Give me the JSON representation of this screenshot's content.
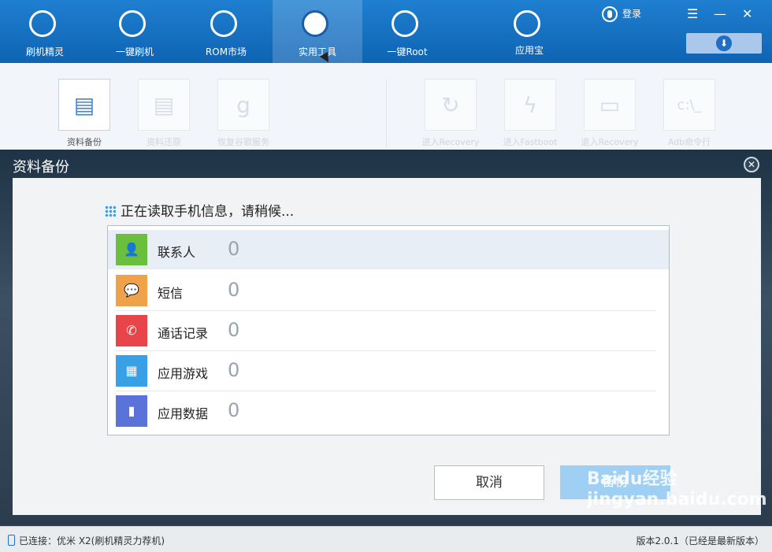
{
  "nav": {
    "items": [
      {
        "label": "刷机精灵",
        "icon": "shield-icon"
      },
      {
        "label": "一键刷机",
        "icon": "cursor-icon"
      },
      {
        "label": "ROM市场",
        "icon": "r-icon"
      },
      {
        "label": "实用工具",
        "icon": "grid-icon"
      },
      {
        "label": "一键Root",
        "icon": "android-icon"
      },
      {
        "label": "应用宝",
        "icon": "app-store-icon"
      }
    ],
    "login": "登录"
  },
  "tools": [
    {
      "label": "资料备份",
      "glyph": "▤"
    },
    {
      "label": "资料还原",
      "glyph": "▤"
    },
    {
      "label": "恢复谷歌服务",
      "glyph": "g"
    },
    {
      "label": "进入Recovery",
      "glyph": "↻"
    },
    {
      "label": "进入Fastboot",
      "glyph": "ϟ"
    },
    {
      "label": "退入Recovery",
      "glyph": "▭"
    },
    {
      "label": "Adb命令行",
      "glyph": "c:\\_"
    }
  ],
  "dialog": {
    "title": "资料备份",
    "heading": "正在读取手机信息，请稍候...",
    "rows": [
      {
        "label": "联系人",
        "value": "0",
        "color": "#6cbf3c",
        "icon": "contact-icon"
      },
      {
        "label": "短信",
        "value": "0",
        "color": "#f0a24a",
        "icon": "sms-icon"
      },
      {
        "label": "通话记录",
        "value": "0",
        "color": "#e8454a",
        "icon": "phone-icon"
      },
      {
        "label": "应用游戏",
        "value": "0",
        "color": "#3aa0e6",
        "icon": "apps-icon"
      },
      {
        "label": "应用数据",
        "value": "0",
        "color": "#5a73d8",
        "icon": "chart-icon"
      }
    ],
    "cancel": "取消",
    "backup": "备份"
  },
  "status": {
    "left": "已连接：优米 X2(刷机精灵力荐机)",
    "right": "版本2.0.1（已经是最新版本）"
  },
  "watermark": "Baidu经验 jingyan.baidu.com"
}
